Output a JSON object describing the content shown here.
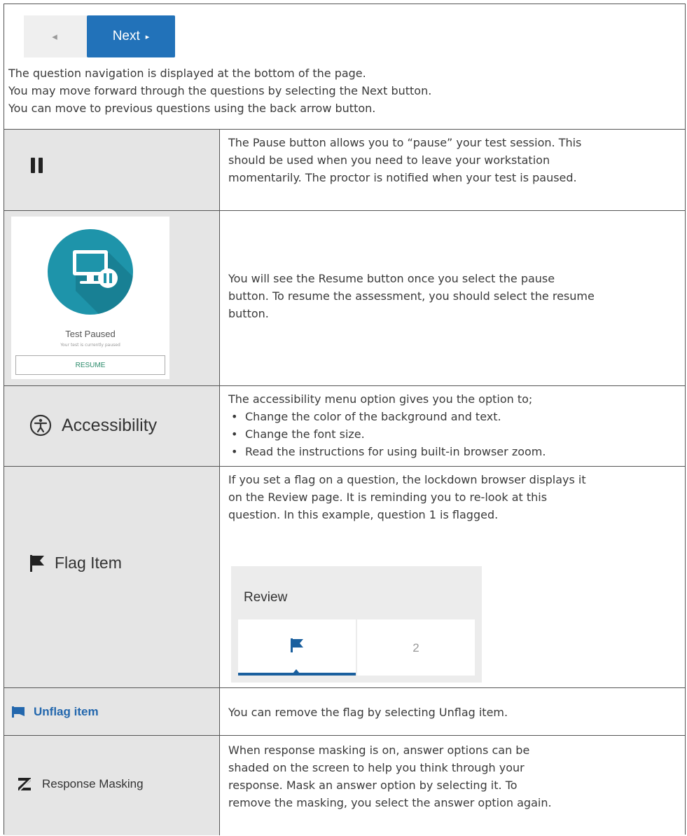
{
  "navigation": {
    "back_label": "◂",
    "next_label": "Next",
    "next_arrow": "▸",
    "lines": [
      "The question navigation is displayed at the bottom of the page.",
      "You may move forward through the questions by selecting the Next button.",
      "You can move to previous questions using the back arrow button."
    ]
  },
  "pause": {
    "icon": "pause-icon",
    "lines": [
      "The Pause button allows you to “pause” your test session.  This",
      "should be used when you need to leave your workstation",
      "momentarily.  The proctor is notified when your test is paused."
    ]
  },
  "resume": {
    "card_title": "Test Paused",
    "card_subtitle": "Your test is currently paused",
    "button_label": "RESUME",
    "icon": "monitor-pause-icon",
    "lines": [
      "You will see the Resume button once you select the pause",
      "button.  To resume the assessment, you should select the resume",
      "button."
    ]
  },
  "accessibility": {
    "label": "Accessibility",
    "icon": "accessibility-icon",
    "intro": "The accessibility menu option gives you the option to;",
    "bullets": [
      "Change the color of the background and text.",
      "Change the font size.",
      "Read the instructions for using built-in browser zoom."
    ],
    "bullet_char": "•"
  },
  "flag": {
    "label": "Flag Item",
    "icon": "flag-icon",
    "lines": [
      "If you set a flag on a question, the lockdown browser displays it",
      "on the Review page. It is reminding you to re-look at this",
      "question.  In this example, question 1 is flagged."
    ],
    "review_title": "Review",
    "review_q2": "2"
  },
  "unflag": {
    "label": "Unflag item",
    "icon": "flag-icon",
    "text": "You can remove the flag by selecting Unflag item."
  },
  "masking": {
    "label": "Response Masking",
    "icon": "masking-icon",
    "lines": [
      "When response masking is on, answer options can be",
      "shaded on the screen to help you think through your",
      "response. Mask an answer option by selecting it. To",
      "remove the masking, you select the answer option again."
    ]
  },
  "colors": {
    "next_button": "#2272b9",
    "paused_circle": "#1e94aa",
    "unflag_label": "#2367ad",
    "resume_text": "#2a8a6a"
  }
}
